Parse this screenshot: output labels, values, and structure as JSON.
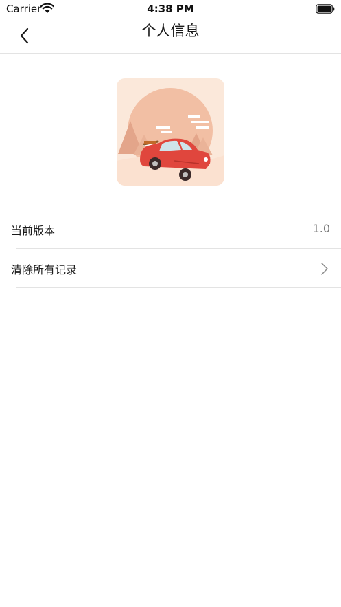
{
  "status_bar": {
    "carrier": "Carrier",
    "time": "4:38 PM",
    "wifi_icon": "wifi-icon",
    "battery_icon": "battery-icon"
  },
  "nav": {
    "title": "个人信息",
    "back_icon": "chevron-left-icon"
  },
  "logo": {
    "icon": "red-car-illustration",
    "accent": "#e0463d",
    "background": "#fbe8da"
  },
  "settings": {
    "items": [
      {
        "label": "当前版本",
        "value": "1.0"
      },
      {
        "label": "清除所有记录",
        "icon": "chevron-right-icon"
      }
    ]
  }
}
